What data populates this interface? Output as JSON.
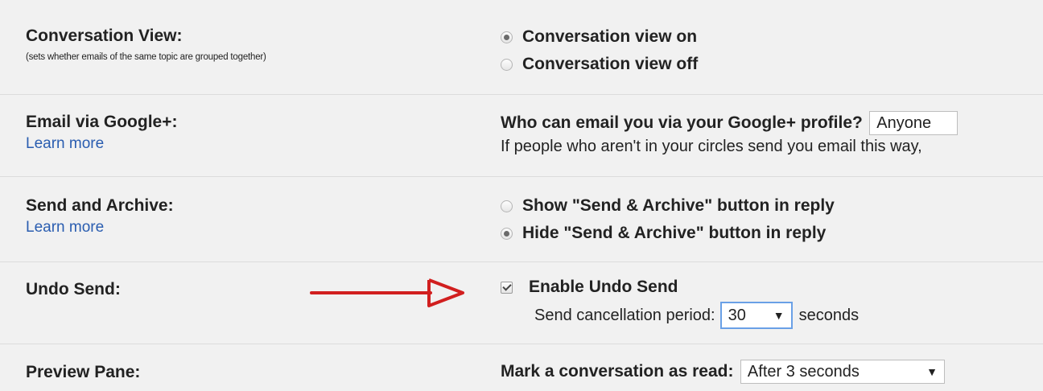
{
  "conversation_view": {
    "title": "Conversation View:",
    "description": "(sets whether emails of the same topic are grouped together)",
    "options": [
      {
        "label": "Conversation view on",
        "checked": true
      },
      {
        "label": "Conversation view off",
        "checked": false
      }
    ]
  },
  "email_via_google": {
    "title": "Email via Google+:",
    "learn_more": "Learn more",
    "question": "Who can email you via your Google+ profile?",
    "selected": "Anyone",
    "note": "If people who aren't in your circles send you email this way,"
  },
  "send_and_archive": {
    "title": "Send and Archive:",
    "learn_more": "Learn more",
    "options": [
      {
        "label": "Show \"Send & Archive\" button in reply",
        "checked": false
      },
      {
        "label": "Hide \"Send & Archive\" button in reply",
        "checked": true
      }
    ]
  },
  "undo_send": {
    "title": "Undo Send:",
    "checkbox_label": "Enable Undo Send",
    "checked": true,
    "period_label": "Send cancellation period:",
    "period_value": "30",
    "period_unit": "seconds",
    "arrow_color": "#d11f1f"
  },
  "preview_pane": {
    "title": "Preview Pane:",
    "mark_label": "Mark a conversation as read:",
    "mark_value": "After 3 seconds"
  },
  "caret_glyph": "▼"
}
